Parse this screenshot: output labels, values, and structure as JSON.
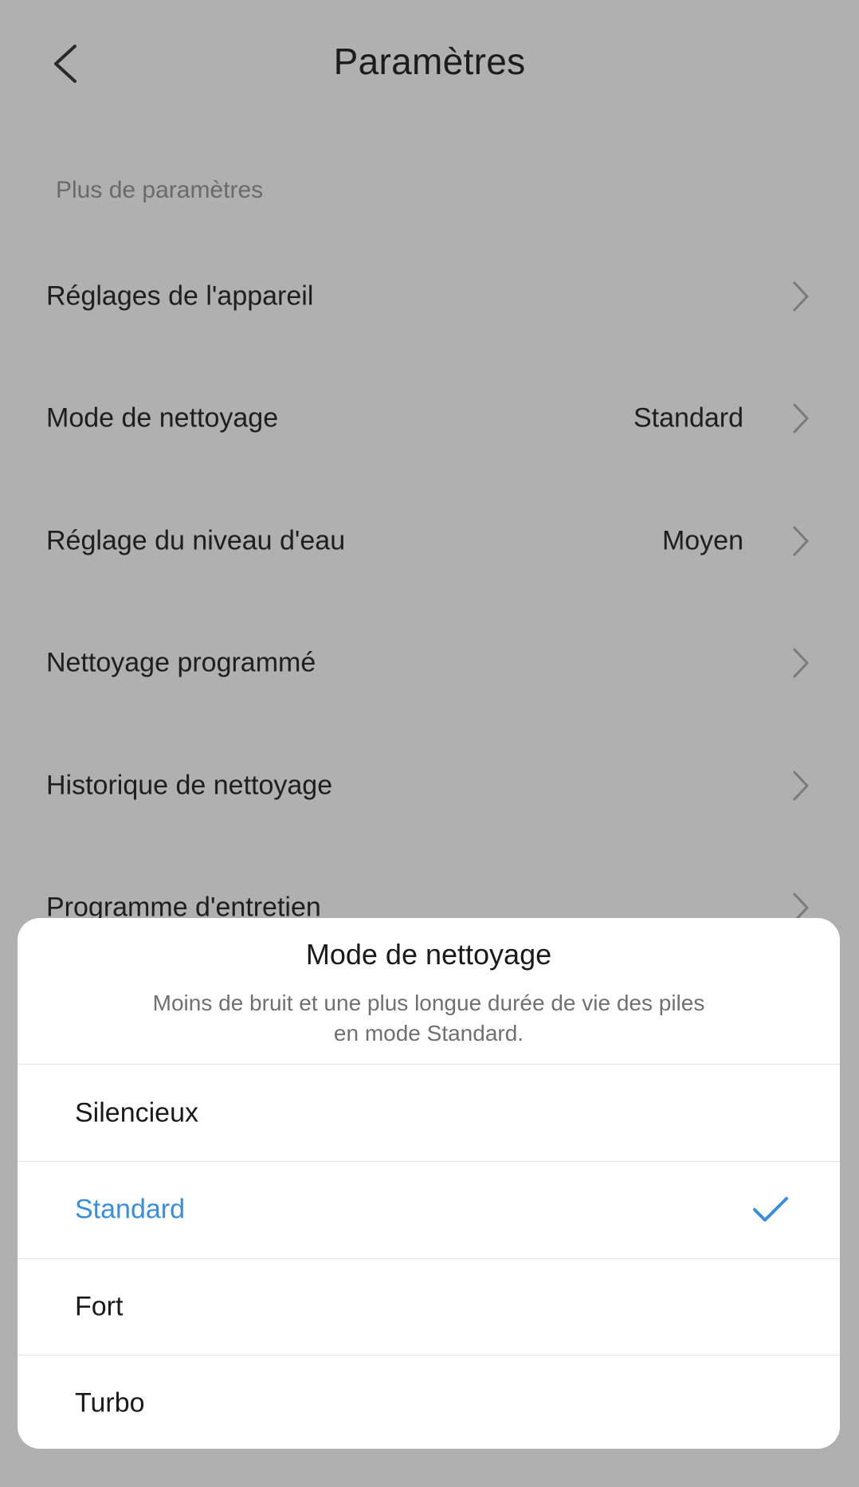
{
  "header": {
    "title": "Paramètres",
    "back_icon": "back-arrow-icon"
  },
  "section": {
    "label": "Plus de paramètres"
  },
  "settings": [
    {
      "label": "Réglages de l'appareil",
      "value": ""
    },
    {
      "label": "Mode de nettoyage",
      "value": "Standard"
    },
    {
      "label": "Réglage du niveau d'eau",
      "value": "Moyen"
    },
    {
      "label": "Nettoyage programmé",
      "value": ""
    },
    {
      "label": "Historique de nettoyage",
      "value": ""
    },
    {
      "label": "Programme d'entretien",
      "value": ""
    }
  ],
  "sheet": {
    "title": "Mode de nettoyage",
    "description_line1": "Moins de bruit et une plus longue durée de vie des piles",
    "description_line2": "en mode Standard.",
    "options": [
      {
        "label": "Silencieux",
        "selected": false
      },
      {
        "label": "Standard",
        "selected": true
      },
      {
        "label": "Fort",
        "selected": false
      },
      {
        "label": "Turbo",
        "selected": false
      }
    ]
  },
  "colors": {
    "accent": "#3a8ee0",
    "overlay_background": "#b0b0b0",
    "sheet_background": "#ffffff"
  },
  "icons": {
    "chevron": "chevron-right-icon",
    "check": "check-icon"
  }
}
